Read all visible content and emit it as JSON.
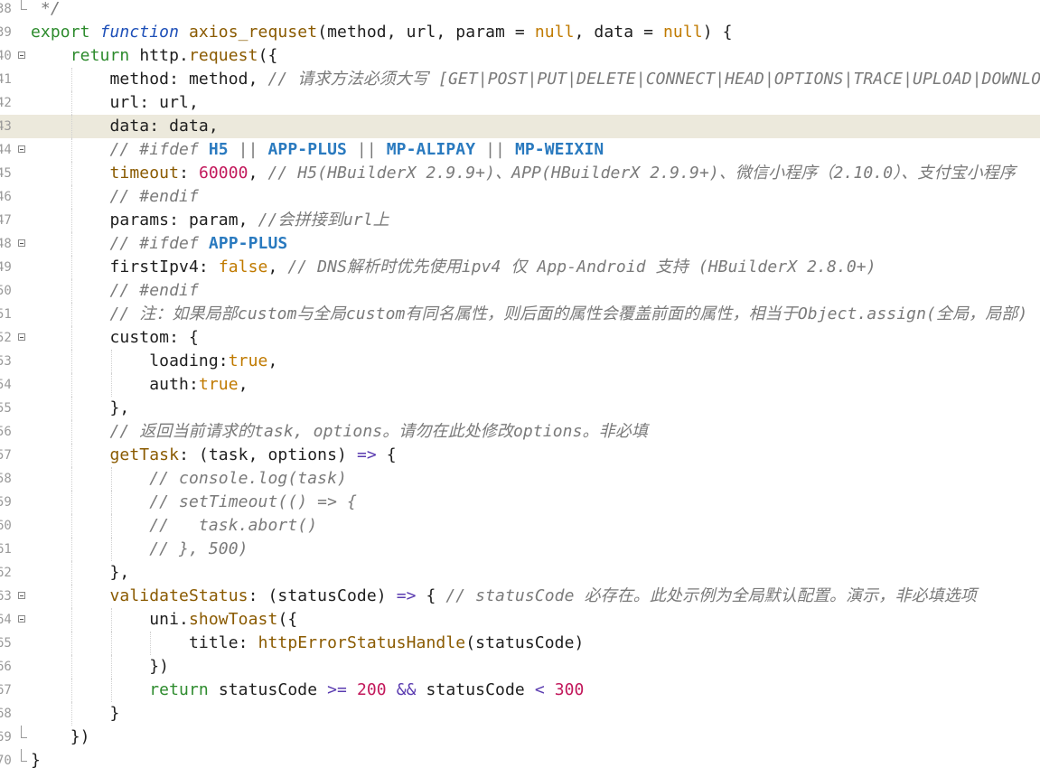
{
  "editor": {
    "title": "",
    "lines": [
      {
        "num": "38",
        "fold": "end",
        "segs": [
          {
            "t": " */",
            "c": "cm"
          }
        ]
      },
      {
        "num": "39",
        "fold": "",
        "segs": [
          {
            "t": "export ",
            "c": "kw"
          },
          {
            "t": "function ",
            "c": "kwi"
          },
          {
            "t": "axios_requset",
            "c": "fn"
          },
          {
            "t": "(method, url, param = ",
            "c": "pr"
          },
          {
            "t": "null",
            "c": "boo"
          },
          {
            "t": ", data = ",
            "c": "pr"
          },
          {
            "t": "null",
            "c": "boo"
          },
          {
            "t": ") {",
            "c": "pr"
          }
        ]
      },
      {
        "num": "40",
        "fold": "open",
        "segs": [
          {
            "t": "    ",
            "c": "pr"
          },
          {
            "t": "return ",
            "c": "kw"
          },
          {
            "t": "http.",
            "c": "pr"
          },
          {
            "t": "request",
            "c": "fn"
          },
          {
            "t": "({",
            "c": "pr"
          }
        ]
      },
      {
        "num": "41",
        "fold": "",
        "segs": [
          {
            "t": "        method: method, ",
            "c": "pr"
          },
          {
            "t": "// 请求方法必须大写 [GET|POST|PUT|DELETE|CONNECT|HEAD|OPTIONS|TRACE|UPLOAD|DOWNLOAD]",
            "c": "cm"
          }
        ]
      },
      {
        "num": "42",
        "fold": "",
        "segs": [
          {
            "t": "        url: url,",
            "c": "pr"
          }
        ]
      },
      {
        "num": "43",
        "fold": "",
        "current": true,
        "segs": [
          {
            "t": "        data: data,",
            "c": "pr"
          }
        ]
      },
      {
        "num": "44",
        "fold": "open",
        "segs": [
          {
            "t": "        ",
            "c": "pr"
          },
          {
            "t": "// #ifdef ",
            "c": "cm"
          },
          {
            "t": "H5",
            "c": "mac"
          },
          {
            "t": " || ",
            "c": "cm"
          },
          {
            "t": "APP-PLUS",
            "c": "mac"
          },
          {
            "t": " || ",
            "c": "cm"
          },
          {
            "t": "MP-ALIPAY",
            "c": "mac"
          },
          {
            "t": " || ",
            "c": "cm"
          },
          {
            "t": "MP-WEIXIN",
            "c": "mac"
          }
        ]
      },
      {
        "num": "45",
        "fold": "",
        "segs": [
          {
            "t": "        ",
            "c": "pr"
          },
          {
            "t": "timeout",
            "c": "fn"
          },
          {
            "t": ": ",
            "c": "pr"
          },
          {
            "t": "60000",
            "c": "num"
          },
          {
            "t": ", ",
            "c": "pr"
          },
          {
            "t": "// H5(HBuilderX 2.9.9+)、APP(HBuilderX 2.9.9+)、微信小程序（2.10.0）、支付宝小程序",
            "c": "cm"
          }
        ]
      },
      {
        "num": "46",
        "fold": "",
        "segs": [
          {
            "t": "        ",
            "c": "pr"
          },
          {
            "t": "// #endif",
            "c": "cm"
          }
        ]
      },
      {
        "num": "47",
        "fold": "",
        "segs": [
          {
            "t": "        params: param, ",
            "c": "pr"
          },
          {
            "t": "//会拼接到url上",
            "c": "cm"
          }
        ]
      },
      {
        "num": "48",
        "fold": "open",
        "segs": [
          {
            "t": "        ",
            "c": "pr"
          },
          {
            "t": "// #ifdef ",
            "c": "cm"
          },
          {
            "t": "APP-PLUS",
            "c": "mac"
          }
        ]
      },
      {
        "num": "49",
        "fold": "",
        "segs": [
          {
            "t": "        firstIpv4: ",
            "c": "pr"
          },
          {
            "t": "false",
            "c": "boo"
          },
          {
            "t": ", ",
            "c": "pr"
          },
          {
            "t": "// DNS解析时优先使用ipv4 仅 App-Android 支持 (HBuilderX 2.8.0+)",
            "c": "cm"
          }
        ]
      },
      {
        "num": "50",
        "fold": "",
        "segs": [
          {
            "t": "        ",
            "c": "pr"
          },
          {
            "t": "// #endif",
            "c": "cm"
          }
        ]
      },
      {
        "num": "51",
        "fold": "",
        "segs": [
          {
            "t": "        ",
            "c": "pr"
          },
          {
            "t": "// 注：如果局部custom与全局custom有同名属性，则后面的属性会覆盖前面的属性，相当于Object.assign(全局，局部)",
            "c": "cm"
          }
        ]
      },
      {
        "num": "52",
        "fold": "open",
        "segs": [
          {
            "t": "        custom: {",
            "c": "pr"
          }
        ]
      },
      {
        "num": "53",
        "fold": "",
        "segs": [
          {
            "t": "            loading:",
            "c": "pr"
          },
          {
            "t": "true",
            "c": "boo"
          },
          {
            "t": ",",
            "c": "pr"
          }
        ]
      },
      {
        "num": "54",
        "fold": "",
        "segs": [
          {
            "t": "            auth:",
            "c": "pr"
          },
          {
            "t": "true",
            "c": "boo"
          },
          {
            "t": ",",
            "c": "pr"
          }
        ]
      },
      {
        "num": "55",
        "fold": "",
        "segs": [
          {
            "t": "        },",
            "c": "pr"
          }
        ]
      },
      {
        "num": "56",
        "fold": "",
        "segs": [
          {
            "t": "        ",
            "c": "pr"
          },
          {
            "t": "// 返回当前请求的task, options。请勿在此处修改options。非必填",
            "c": "cm"
          }
        ]
      },
      {
        "num": "57",
        "fold": "",
        "segs": [
          {
            "t": "        ",
            "c": "pr"
          },
          {
            "t": "getTask",
            "c": "fn"
          },
          {
            "t": ": (task, options) ",
            "c": "pr"
          },
          {
            "t": "=>",
            "c": "op"
          },
          {
            "t": " {",
            "c": "pr"
          }
        ]
      },
      {
        "num": "58",
        "fold": "",
        "segs": [
          {
            "t": "            ",
            "c": "pr"
          },
          {
            "t": "// console.log(task)",
            "c": "cm"
          }
        ]
      },
      {
        "num": "59",
        "fold": "",
        "segs": [
          {
            "t": "            ",
            "c": "pr"
          },
          {
            "t": "// setTimeout(() => {",
            "c": "cm"
          }
        ]
      },
      {
        "num": "60",
        "fold": "",
        "segs": [
          {
            "t": "            ",
            "c": "pr"
          },
          {
            "t": "//   task.abort()",
            "c": "cm"
          }
        ]
      },
      {
        "num": "61",
        "fold": "",
        "segs": [
          {
            "t": "            ",
            "c": "pr"
          },
          {
            "t": "// }, 500)",
            "c": "cm"
          }
        ]
      },
      {
        "num": "62",
        "fold": "",
        "segs": [
          {
            "t": "        },",
            "c": "pr"
          }
        ]
      },
      {
        "num": "63",
        "fold": "open",
        "segs": [
          {
            "t": "        ",
            "c": "pr"
          },
          {
            "t": "validateStatus",
            "c": "fn"
          },
          {
            "t": ": (statusCode) ",
            "c": "pr"
          },
          {
            "t": "=>",
            "c": "op"
          },
          {
            "t": " { ",
            "c": "pr"
          },
          {
            "t": "// statusCode 必存在。此处示例为全局默认配置。演示，非必填选项",
            "c": "cm"
          }
        ]
      },
      {
        "num": "64",
        "fold": "open",
        "segs": [
          {
            "t": "            uni.",
            "c": "pr"
          },
          {
            "t": "showToast",
            "c": "fn"
          },
          {
            "t": "({",
            "c": "pr"
          }
        ]
      },
      {
        "num": "65",
        "fold": "",
        "segs": [
          {
            "t": "                title: ",
            "c": "pr"
          },
          {
            "t": "httpErrorStatusHandle",
            "c": "fn"
          },
          {
            "t": "(statusCode)",
            "c": "pr"
          }
        ]
      },
      {
        "num": "66",
        "fold": "",
        "segs": [
          {
            "t": "            })",
            "c": "pr"
          }
        ]
      },
      {
        "num": "67",
        "fold": "",
        "segs": [
          {
            "t": "            ",
            "c": "pr"
          },
          {
            "t": "return ",
            "c": "kw"
          },
          {
            "t": "statusCode ",
            "c": "pr"
          },
          {
            "t": ">=",
            "c": "op"
          },
          {
            "t": " ",
            "c": "pr"
          },
          {
            "t": "200",
            "c": "num"
          },
          {
            "t": " ",
            "c": "pr"
          },
          {
            "t": "&&",
            "c": "op"
          },
          {
            "t": " statusCode ",
            "c": "pr"
          },
          {
            "t": "<",
            "c": "op"
          },
          {
            "t": " ",
            "c": "pr"
          },
          {
            "t": "300",
            "c": "num"
          }
        ]
      },
      {
        "num": "68",
        "fold": "",
        "segs": [
          {
            "t": "        }",
            "c": "pr"
          }
        ]
      },
      {
        "num": "69",
        "fold": "end",
        "segs": [
          {
            "t": "    })",
            "c": "pr"
          }
        ]
      },
      {
        "num": "70",
        "fold": "end",
        "segs": [
          {
            "t": "}",
            "c": "pr"
          }
        ]
      }
    ]
  }
}
